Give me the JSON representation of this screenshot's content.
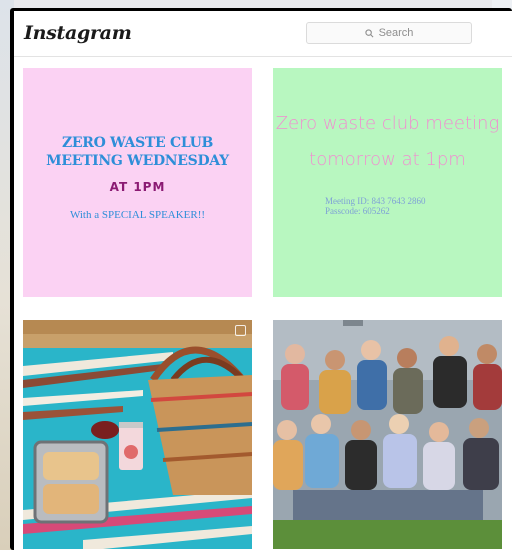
{
  "app": {
    "logo": "Instagram"
  },
  "search": {
    "placeholder": "Search"
  },
  "posts": [
    {
      "title": "ZERO WASTE CLUB\nMEETING WEDNESDAY",
      "time": "AT 1PM",
      "note": "With a SPECIAL SPEAKER!!",
      "color": "#fbd2f3"
    },
    {
      "title": "Zero waste club meeting\ntomorrow at 1pm",
      "details": "Meeting ID: 843 7643 2860\nPasscode: 605262",
      "color": "#b8f7c0"
    },
    {
      "image": "picnic-photo"
    },
    {
      "image": "group-photo"
    }
  ]
}
